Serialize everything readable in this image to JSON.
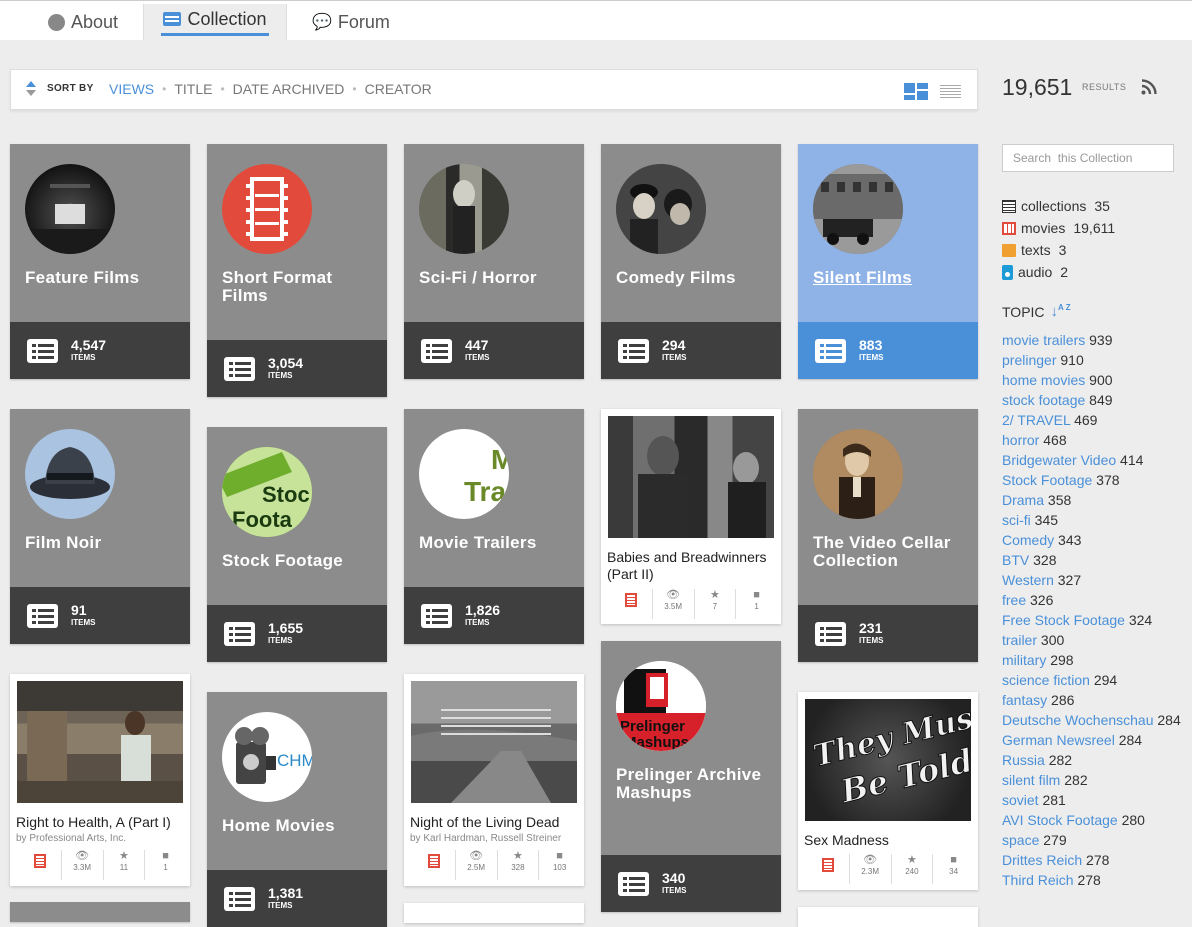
{
  "tabs": [
    {
      "label": "About"
    },
    {
      "label": "Collection"
    },
    {
      "label": "Forum"
    }
  ],
  "sort": {
    "label": "SORT BY",
    "options": [
      "VIEWS",
      "TITLE",
      "DATE ARCHIVED",
      "CREATOR"
    ],
    "selected": "VIEWS"
  },
  "results": {
    "count": "19,651",
    "label": "RESULTS"
  },
  "search": {
    "placeholder": "Search  this Collection"
  },
  "mediatypes": [
    {
      "icon": "collection-icon",
      "name": "collections",
      "count": "35"
    },
    {
      "icon": "movies-icon",
      "name": "movies",
      "count": "19,611"
    },
    {
      "icon": "texts-icon",
      "name": "texts",
      "count": "3"
    },
    {
      "icon": "audio-icon",
      "name": "audio",
      "count": "2"
    }
  ],
  "topic": {
    "label": "TOPIC",
    "items": [
      {
        "name": "movie trailers",
        "count": "939"
      },
      {
        "name": "prelinger",
        "count": "910"
      },
      {
        "name": "home movies",
        "count": "900"
      },
      {
        "name": "stock footage",
        "count": "849"
      },
      {
        "name": "2/ TRAVEL",
        "count": "469"
      },
      {
        "name": "horror",
        "count": "468"
      },
      {
        "name": "Bridgewater Video",
        "count": "414"
      },
      {
        "name": "Stock Footage",
        "count": "378"
      },
      {
        "name": "Drama",
        "count": "358"
      },
      {
        "name": "sci-fi",
        "count": "345"
      },
      {
        "name": "Comedy",
        "count": "343"
      },
      {
        "name": "BTV",
        "count": "328"
      },
      {
        "name": "Western",
        "count": "327"
      },
      {
        "name": "free",
        "count": "326"
      },
      {
        "name": "Free Stock Footage",
        "count": "324"
      },
      {
        "name": "trailer",
        "count": "300"
      },
      {
        "name": "military",
        "count": "298"
      },
      {
        "name": "science fiction",
        "count": "294"
      },
      {
        "name": "fantasy",
        "count": "286"
      },
      {
        "name": "Deutsche Wochenschau",
        "count": "284"
      },
      {
        "name": "German Newsreel",
        "count": "284"
      },
      {
        "name": "Russia",
        "count": "282"
      },
      {
        "name": "silent film",
        "count": "282"
      },
      {
        "name": "soviet",
        "count": "281"
      },
      {
        "name": "AVI Stock Footage",
        "count": "280"
      },
      {
        "name": "space",
        "count": "279"
      },
      {
        "name": "Drittes Reich",
        "count": "278"
      },
      {
        "name": "Third Reich",
        "count": "278"
      }
    ]
  },
  "collections": [
    {
      "title": "Feature Films",
      "count": "4,547",
      "items_label": "ITEMS"
    },
    {
      "title": "Short Format Films",
      "count": "3,054",
      "items_label": "ITEMS"
    },
    {
      "title": "Sci-Fi / Horror",
      "count": "447",
      "items_label": "ITEMS"
    },
    {
      "title": "Comedy Films",
      "count": "294",
      "items_label": "ITEMS"
    },
    {
      "title": "Silent Films",
      "count": "883",
      "items_label": "ITEMS"
    },
    {
      "title": "Film Noir",
      "count": "91",
      "items_label": "ITEMS"
    },
    {
      "title": "Stock Footage",
      "count": "1,655",
      "items_label": "ITEMS"
    },
    {
      "title": "Movie Trailers",
      "count": "1,826",
      "items_label": "ITEMS"
    },
    {
      "title": "The Video Cellar Collection",
      "count": "231",
      "items_label": "ITEMS"
    },
    {
      "title": "Home Movies",
      "count": "1,381",
      "items_label": "ITEMS"
    },
    {
      "title": "Prelinger Archive Mashups",
      "count": "340",
      "items_label": "ITEMS"
    }
  ],
  "logos": {
    "stock_footage": "Stock Foota",
    "movie_trailers": "Tra",
    "home_movies": "CHM",
    "prelinger": "Prelinger Mashup",
    "sex_madness": "They Must Be Told!"
  },
  "items": [
    {
      "title": "Babies and Breadwinners (Part II)",
      "by": "",
      "views": "3.5M",
      "favs": "7",
      "reviews": "1"
    },
    {
      "title": "Right to Health, A (Part I)",
      "by": "by Professional Arts, Inc.",
      "views": "3.3M",
      "favs": "11",
      "reviews": "1"
    },
    {
      "title": "Night of the Living Dead",
      "by": "by Karl Hardman, Russell Streiner",
      "views": "2.5M",
      "favs": "328",
      "reviews": "103"
    },
    {
      "title": "Sex Madness",
      "by": "",
      "views": "2.3M",
      "favs": "240",
      "reviews": "34"
    }
  ],
  "colors": {
    "accent": "#4a90d9",
    "card": "#8c8c8c",
    "card_footer": "#3f3f3f",
    "selected_card": "#8fb3e6",
    "movie_red": "#e24b3b"
  }
}
